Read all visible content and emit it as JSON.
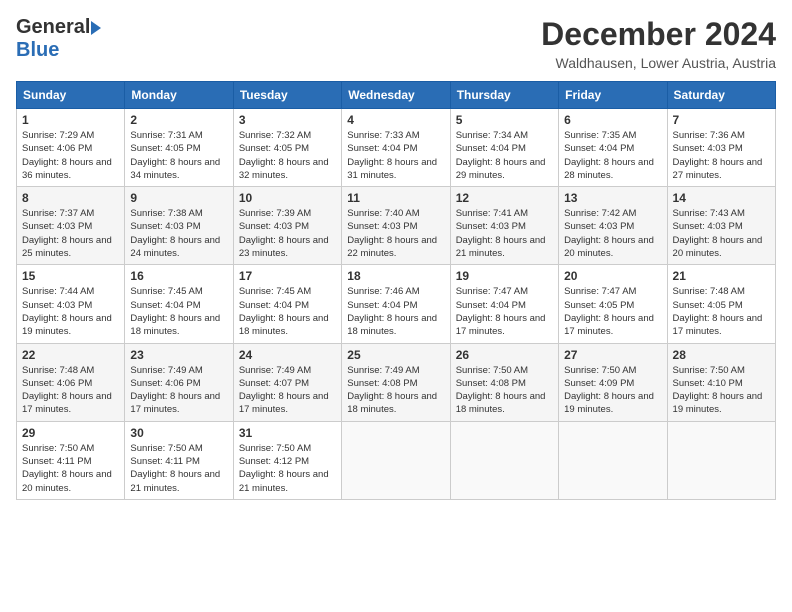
{
  "header": {
    "logo_general": "General",
    "logo_blue": "Blue",
    "month_title": "December 2024",
    "location": "Waldhausen, Lower Austria, Austria"
  },
  "days_of_week": [
    "Sunday",
    "Monday",
    "Tuesday",
    "Wednesday",
    "Thursday",
    "Friday",
    "Saturday"
  ],
  "weeks": [
    [
      {
        "day": "1",
        "sunrise": "Sunrise: 7:29 AM",
        "sunset": "Sunset: 4:06 PM",
        "daylight": "Daylight: 8 hours and 36 minutes."
      },
      {
        "day": "2",
        "sunrise": "Sunrise: 7:31 AM",
        "sunset": "Sunset: 4:05 PM",
        "daylight": "Daylight: 8 hours and 34 minutes."
      },
      {
        "day": "3",
        "sunrise": "Sunrise: 7:32 AM",
        "sunset": "Sunset: 4:05 PM",
        "daylight": "Daylight: 8 hours and 32 minutes."
      },
      {
        "day": "4",
        "sunrise": "Sunrise: 7:33 AM",
        "sunset": "Sunset: 4:04 PM",
        "daylight": "Daylight: 8 hours and 31 minutes."
      },
      {
        "day": "5",
        "sunrise": "Sunrise: 7:34 AM",
        "sunset": "Sunset: 4:04 PM",
        "daylight": "Daylight: 8 hours and 29 minutes."
      },
      {
        "day": "6",
        "sunrise": "Sunrise: 7:35 AM",
        "sunset": "Sunset: 4:04 PM",
        "daylight": "Daylight: 8 hours and 28 minutes."
      },
      {
        "day": "7",
        "sunrise": "Sunrise: 7:36 AM",
        "sunset": "Sunset: 4:03 PM",
        "daylight": "Daylight: 8 hours and 27 minutes."
      }
    ],
    [
      {
        "day": "8",
        "sunrise": "Sunrise: 7:37 AM",
        "sunset": "Sunset: 4:03 PM",
        "daylight": "Daylight: 8 hours and 25 minutes."
      },
      {
        "day": "9",
        "sunrise": "Sunrise: 7:38 AM",
        "sunset": "Sunset: 4:03 PM",
        "daylight": "Daylight: 8 hours and 24 minutes."
      },
      {
        "day": "10",
        "sunrise": "Sunrise: 7:39 AM",
        "sunset": "Sunset: 4:03 PM",
        "daylight": "Daylight: 8 hours and 23 minutes."
      },
      {
        "day": "11",
        "sunrise": "Sunrise: 7:40 AM",
        "sunset": "Sunset: 4:03 PM",
        "daylight": "Daylight: 8 hours and 22 minutes."
      },
      {
        "day": "12",
        "sunrise": "Sunrise: 7:41 AM",
        "sunset": "Sunset: 4:03 PM",
        "daylight": "Daylight: 8 hours and 21 minutes."
      },
      {
        "day": "13",
        "sunrise": "Sunrise: 7:42 AM",
        "sunset": "Sunset: 4:03 PM",
        "daylight": "Daylight: 8 hours and 20 minutes."
      },
      {
        "day": "14",
        "sunrise": "Sunrise: 7:43 AM",
        "sunset": "Sunset: 4:03 PM",
        "daylight": "Daylight: 8 hours and 20 minutes."
      }
    ],
    [
      {
        "day": "15",
        "sunrise": "Sunrise: 7:44 AM",
        "sunset": "Sunset: 4:03 PM",
        "daylight": "Daylight: 8 hours and 19 minutes."
      },
      {
        "day": "16",
        "sunrise": "Sunrise: 7:45 AM",
        "sunset": "Sunset: 4:04 PM",
        "daylight": "Daylight: 8 hours and 18 minutes."
      },
      {
        "day": "17",
        "sunrise": "Sunrise: 7:45 AM",
        "sunset": "Sunset: 4:04 PM",
        "daylight": "Daylight: 8 hours and 18 minutes."
      },
      {
        "day": "18",
        "sunrise": "Sunrise: 7:46 AM",
        "sunset": "Sunset: 4:04 PM",
        "daylight": "Daylight: 8 hours and 18 minutes."
      },
      {
        "day": "19",
        "sunrise": "Sunrise: 7:47 AM",
        "sunset": "Sunset: 4:04 PM",
        "daylight": "Daylight: 8 hours and 17 minutes."
      },
      {
        "day": "20",
        "sunrise": "Sunrise: 7:47 AM",
        "sunset": "Sunset: 4:05 PM",
        "daylight": "Daylight: 8 hours and 17 minutes."
      },
      {
        "day": "21",
        "sunrise": "Sunrise: 7:48 AM",
        "sunset": "Sunset: 4:05 PM",
        "daylight": "Daylight: 8 hours and 17 minutes."
      }
    ],
    [
      {
        "day": "22",
        "sunrise": "Sunrise: 7:48 AM",
        "sunset": "Sunset: 4:06 PM",
        "daylight": "Daylight: 8 hours and 17 minutes."
      },
      {
        "day": "23",
        "sunrise": "Sunrise: 7:49 AM",
        "sunset": "Sunset: 4:06 PM",
        "daylight": "Daylight: 8 hours and 17 minutes."
      },
      {
        "day": "24",
        "sunrise": "Sunrise: 7:49 AM",
        "sunset": "Sunset: 4:07 PM",
        "daylight": "Daylight: 8 hours and 17 minutes."
      },
      {
        "day": "25",
        "sunrise": "Sunrise: 7:49 AM",
        "sunset": "Sunset: 4:08 PM",
        "daylight": "Daylight: 8 hours and 18 minutes."
      },
      {
        "day": "26",
        "sunrise": "Sunrise: 7:50 AM",
        "sunset": "Sunset: 4:08 PM",
        "daylight": "Daylight: 8 hours and 18 minutes."
      },
      {
        "day": "27",
        "sunrise": "Sunrise: 7:50 AM",
        "sunset": "Sunset: 4:09 PM",
        "daylight": "Daylight: 8 hours and 19 minutes."
      },
      {
        "day": "28",
        "sunrise": "Sunrise: 7:50 AM",
        "sunset": "Sunset: 4:10 PM",
        "daylight": "Daylight: 8 hours and 19 minutes."
      }
    ],
    [
      {
        "day": "29",
        "sunrise": "Sunrise: 7:50 AM",
        "sunset": "Sunset: 4:11 PM",
        "daylight": "Daylight: 8 hours and 20 minutes."
      },
      {
        "day": "30",
        "sunrise": "Sunrise: 7:50 AM",
        "sunset": "Sunset: 4:11 PM",
        "daylight": "Daylight: 8 hours and 21 minutes."
      },
      {
        "day": "31",
        "sunrise": "Sunrise: 7:50 AM",
        "sunset": "Sunset: 4:12 PM",
        "daylight": "Daylight: 8 hours and 21 minutes."
      },
      null,
      null,
      null,
      null
    ]
  ]
}
